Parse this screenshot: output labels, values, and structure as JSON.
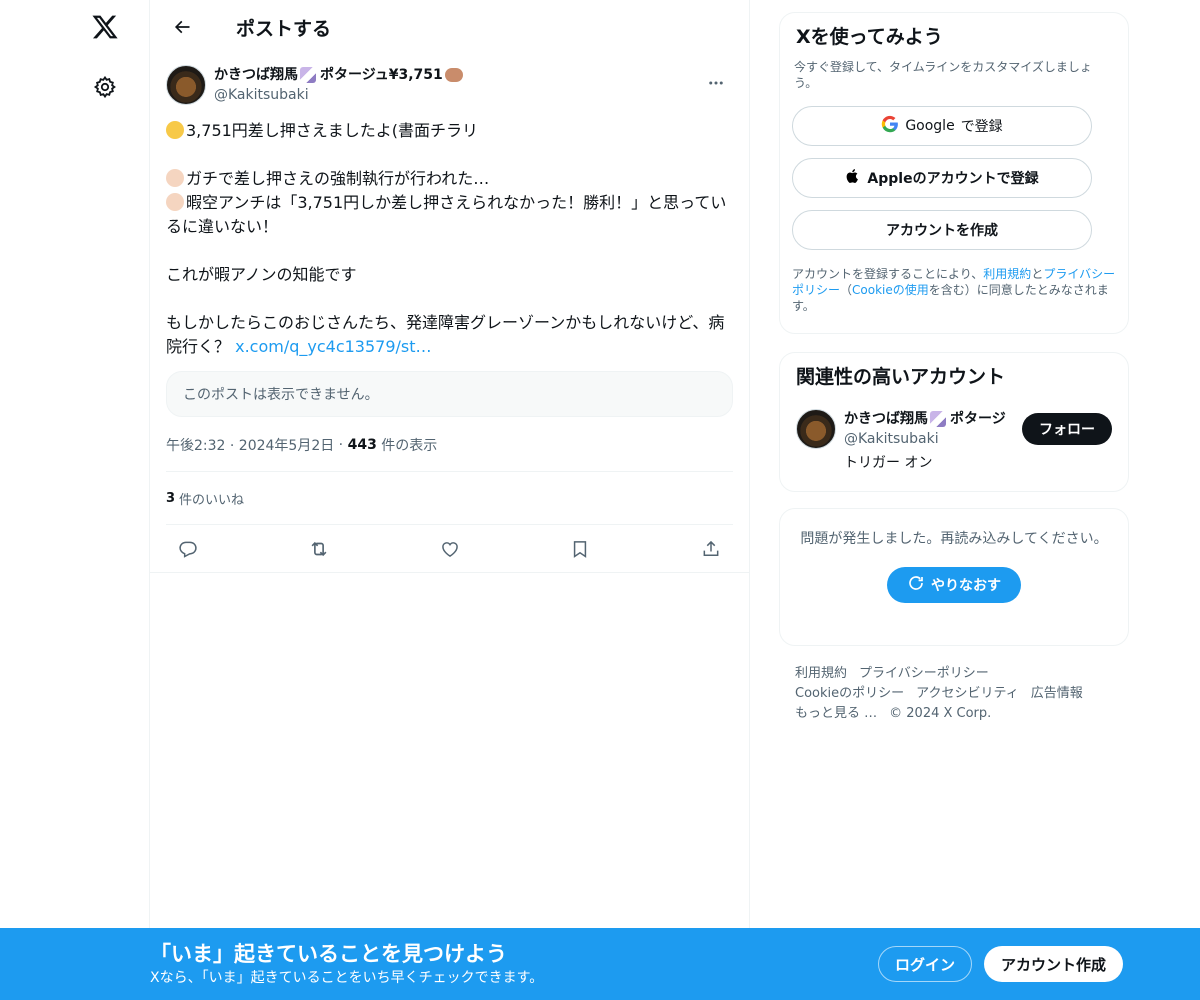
{
  "nav": {
    "logo_icon": "x-logo-icon",
    "settings_icon": "gear-icon"
  },
  "header": {
    "title": "ポストする",
    "back_icon": "arrow-left-icon"
  },
  "post": {
    "author": {
      "display_name": "かきつば翔馬",
      "display_name_suffix": "ポタージュ¥3,751",
      "handle": "@Kakitsubaki"
    },
    "body": {
      "line1": "3,751円差し押さえましたよ(書面チラリ",
      "line2": "ガチで差し押さえの強制執行が行われた…",
      "line3": "暇空アンチは「3,751円しか差し押さえられなかった！勝利！」と思っているに違いない！",
      "line4": "これが暇アノンの知能です",
      "line5": "もしかしたらこのおじさんたち、発達障害グレーゾーンかもしれないけど、病院行く？ ",
      "link_text": "x.com/q_yc4c13579/st…"
    },
    "quote_unavailable": "このポストは表示できません。",
    "meta": {
      "time": "午後2:32 · 2024年5月2日",
      "separator": " · ",
      "views_count": "443",
      "views_label": " 件の表示"
    },
    "likes": {
      "count": "3",
      "label": "件のいいね"
    },
    "actions": [
      "reply-icon",
      "repost-icon",
      "like-icon",
      "bookmark-icon",
      "share-icon"
    ]
  },
  "signup": {
    "title": "Xを使ってみよう",
    "subtitle": "今すぐ登録して、タイムラインをカスタマイズしましょう。",
    "google_label": "で登録",
    "google_brand": "Google",
    "apple_label": "Appleのアカウントで登録",
    "create_label": "アカウントを作成",
    "legal_prefix": "アカウントを登録することにより、",
    "legal_terms": "利用規約",
    "legal_and": "と",
    "legal_privacy": "プライバシーポリシー",
    "legal_open": "（",
    "legal_cookie": "Cookieの使用",
    "legal_suffix": "を含む）に同意したとみなされます。"
  },
  "related": {
    "title": "関連性の高いアカウント",
    "name": "かきつば翔馬",
    "name_suffix": "ポタージ",
    "handle": "@Kakitsubaki",
    "bio": "トリガー オン",
    "follow_label": "フォロー"
  },
  "error": {
    "message": "問題が発生しました。再読み込みしてください。",
    "retry_label": "やりなおす"
  },
  "footer": {
    "links": [
      "利用規約",
      "プライバシーポリシー",
      "Cookieのポリシー",
      "アクセシビリティ",
      "広告情報",
      "もっと見る …"
    ],
    "copyright": "© 2024 X Corp."
  },
  "banner": {
    "title": "「いま」起きていることを見つけよう",
    "subtitle": "Xなら、「いま」起きていることをいち早くチェックできます。",
    "login_label": "ログイン",
    "signup_label": "アカウント作成"
  },
  "colors": {
    "accent": "#1d9bf0",
    "text": "#0f1419",
    "muted": "#536471",
    "border": "#eff3f4"
  }
}
